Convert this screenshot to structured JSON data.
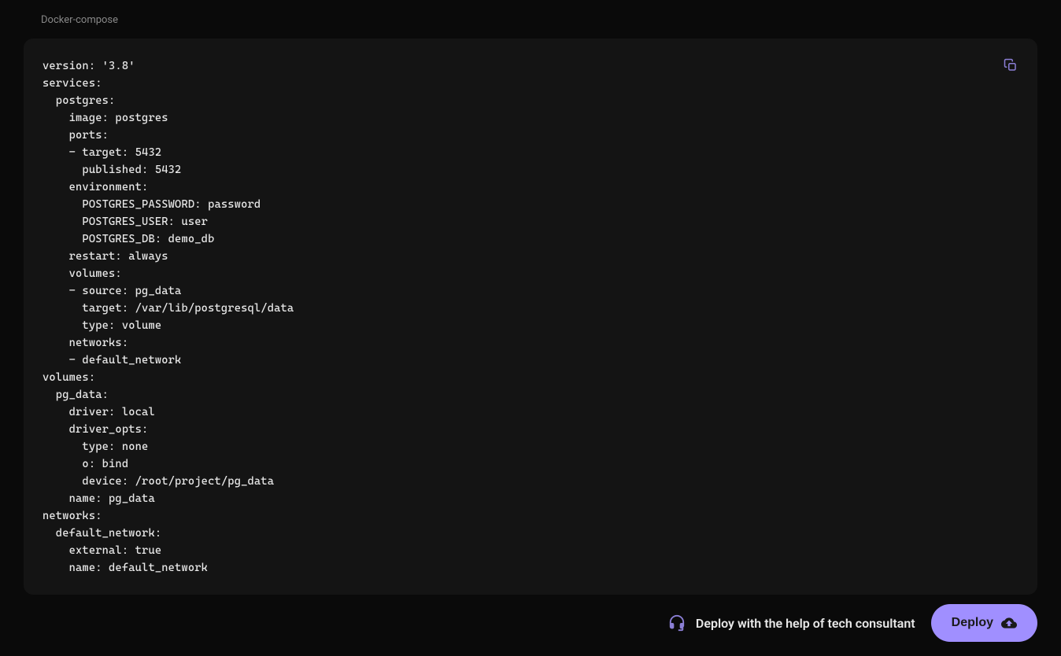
{
  "header": {
    "title": "Docker-compose"
  },
  "code": {
    "content": "version: '3.8'\nservices:\n  postgres:\n    image: postgres\n    ports:\n    - target: 5432\n      published: 5432\n    environment:\n      POSTGRES_PASSWORD: password\n      POSTGRES_USER: user\n      POSTGRES_DB: demo_db\n    restart: always\n    volumes:\n    - source: pg_data\n      target: /var/lib/postgresql/data\n      type: volume\n    networks:\n    - default_network\nvolumes:\n  pg_data:\n    driver: local\n    driver_opts:\n      type: none\n      o: bind\n      device: /root/project/pg_data\n    name: pg_data\nnetworks:\n  default_network:\n    external: true\n    name: default_network"
  },
  "footer": {
    "consultant_label": "Deploy with the help of tech consultant",
    "deploy_label": "Deploy"
  }
}
